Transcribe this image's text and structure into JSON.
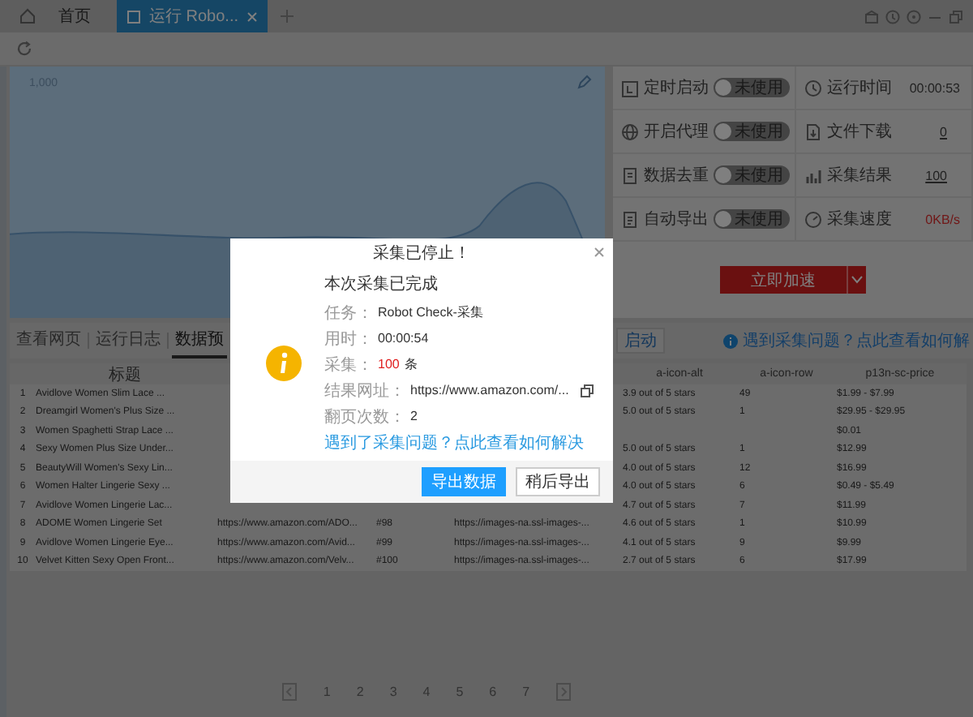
{
  "top_bar": {
    "tabs": [
      {
        "label": "首页",
        "selected": false
      },
      {
        "label": "运行 Robo...",
        "selected": true
      }
    ]
  },
  "chart": {
    "y_label": "1,000"
  },
  "settings": [
    {
      "label": "定时启动",
      "kind": "toggle",
      "on": false,
      "state_text": "未使用"
    },
    {
      "label": "运行时间",
      "kind": "text",
      "value": "00:00:53"
    },
    {
      "label": "开启代理",
      "kind": "toggle",
      "on": false,
      "state_text": "未使用"
    },
    {
      "label": "文件下载",
      "kind": "link",
      "value": "0"
    },
    {
      "label": "数据去重",
      "kind": "toggle",
      "on": false,
      "state_text": "未使用"
    },
    {
      "label": "采集结果",
      "kind": "link",
      "value": "100"
    },
    {
      "label": "自动导出",
      "kind": "toggle",
      "on": false,
      "state_text": "未使用"
    },
    {
      "label": "采集速度",
      "kind": "alert",
      "value": "0KB/s"
    }
  ],
  "accelerate_button": {
    "label": "立即加速"
  },
  "view_tabs": [
    {
      "label": "查看网页",
      "selected": false
    },
    {
      "label": "运行日志",
      "selected": false
    },
    {
      "label": "数据预",
      "selected": true
    }
  ],
  "start_button": {
    "label": "启动"
  },
  "help_link": "遇到采集问题？点此查看如何解",
  "table": {
    "columns": {
      "title": "标题",
      "a_icon_alt": "a-icon-alt",
      "a_icon_row": "a-icon-row",
      "price": "p13n-sc-price"
    },
    "rows": [
      {
        "index": "1",
        "title": "Avidlove Women Slim Lace ...",
        "a_icon_alt": "3.9 out of 5 stars",
        "a_icon_row": "49",
        "price": "$1.99 - $7.99"
      },
      {
        "index": "2",
        "title": "Dreamgirl Women's Plus Size ...",
        "a_icon_alt": "5.0 out of 5 stars",
        "a_icon_row": "1",
        "price": "$29.95 - $29.95"
      },
      {
        "index": "3",
        "title": "Women Spaghetti Strap Lace ...",
        "price": "$0.01"
      },
      {
        "index": "4",
        "title": "Sexy Women Plus Size Under...",
        "a_icon_alt": "5.0 out of 5 stars",
        "a_icon_row": "1",
        "price": "$12.99"
      },
      {
        "index": "5",
        "title": "BeautyWill Women's Sexy Lin...",
        "a_icon_alt": "4.0 out of 5 stars",
        "a_icon_row": "12",
        "price": "$16.99"
      },
      {
        "index": "6",
        "title": "Women Halter Lingerie Sexy ...",
        "a_icon_alt": "4.0 out of 5 stars",
        "a_icon_row": "6",
        "price": "$0.49 - $5.49"
      },
      {
        "index": "7",
        "title": "Avidlove Women Lingerie Lac...",
        "a_icon_alt": "4.7 out of 5 stars",
        "a_icon_row": "7",
        "price": "$11.99"
      },
      {
        "index": "8",
        "title": "ADOME Women Lingerie Set",
        "column_3": "https://www.amazon.com/ADO...",
        "column_4": "#98",
        "column_5": "https://images-na.ssl-images-...",
        "a_icon_alt": "4.6 out of 5 stars",
        "a_icon_row": "1",
        "price": "$10.99"
      },
      {
        "index": "9",
        "title": "Avidlove Women Lingerie Eye...",
        "column_3": "https://www.amazon.com/Avid...",
        "column_4": "#99",
        "column_5": "https://images-na.ssl-images-...",
        "a_icon_alt": "4.1 out of 5 stars",
        "a_icon_row": "9",
        "price": "$9.99"
      },
      {
        "index": "10",
        "title": "Velvet Kitten Sexy Open Front...",
        "column_3": "https://www.amazon.com/Velv...",
        "column_4": "#100",
        "column_5": "https://images-na.ssl-images-...",
        "a_icon_alt": "2.7 out of 5 stars",
        "a_icon_row": "6",
        "price": "$17.99"
      }
    ]
  },
  "pagination": {
    "pages": [
      "1",
      "2",
      "3",
      "4",
      "5",
      "6",
      "7"
    ]
  },
  "dialog": {
    "title": "采集已停止！",
    "heading": "本次采集已完成",
    "fields": [
      {
        "label": "任务：",
        "value": "Robot Check-采集",
        "kind": "text"
      },
      {
        "label": "用时：",
        "value": "00:00:54",
        "kind": "text"
      },
      {
        "label": "采集：",
        "value": "100",
        "unit": "条",
        "kind": "count"
      },
      {
        "label": "结果网址：",
        "value": "https://www.amazon.com/...",
        "kind": "url"
      },
      {
        "label": "翻页次数：",
        "value": "2",
        "kind": "text"
      }
    ],
    "help_link": "遇到了采集问题？点此查看如何解决",
    "buttons": [
      {
        "label": "导出数据",
        "kind": "primary"
      },
      {
        "label": "稍后导出",
        "kind": "secondary"
      }
    ]
  }
}
